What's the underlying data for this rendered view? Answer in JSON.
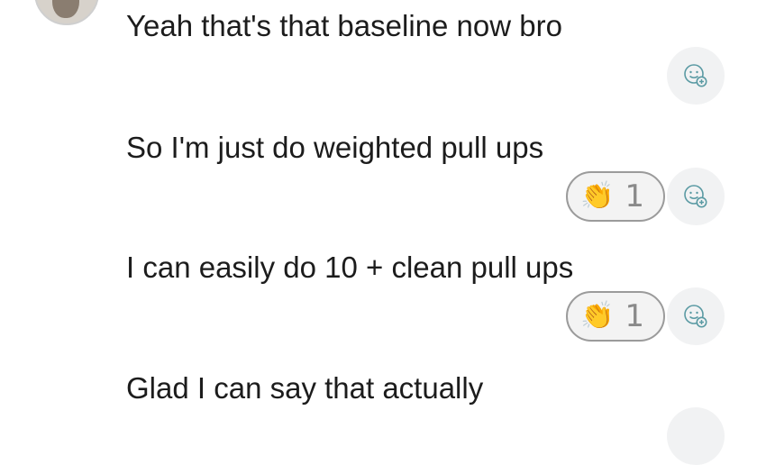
{
  "messages": [
    {
      "text": "Yeah that's that baseline now bro"
    },
    {
      "text": "So I'm just do weighted pull ups",
      "reaction": {
        "emoji": "👏",
        "count": "1"
      }
    },
    {
      "text": "I can easily do 10 + clean pull ups",
      "reaction": {
        "emoji": "👏",
        "count": "1"
      }
    },
    {
      "text": "Glad I can say that actually"
    }
  ],
  "icons": {
    "add_reaction": "add-reaction-icon",
    "clap": "clapping-hands-icon"
  },
  "colors": {
    "background": "#ffffff",
    "text": "#1c1c1c",
    "reaction_border": "#9b9b9b",
    "icon": "#5a9aa3"
  }
}
